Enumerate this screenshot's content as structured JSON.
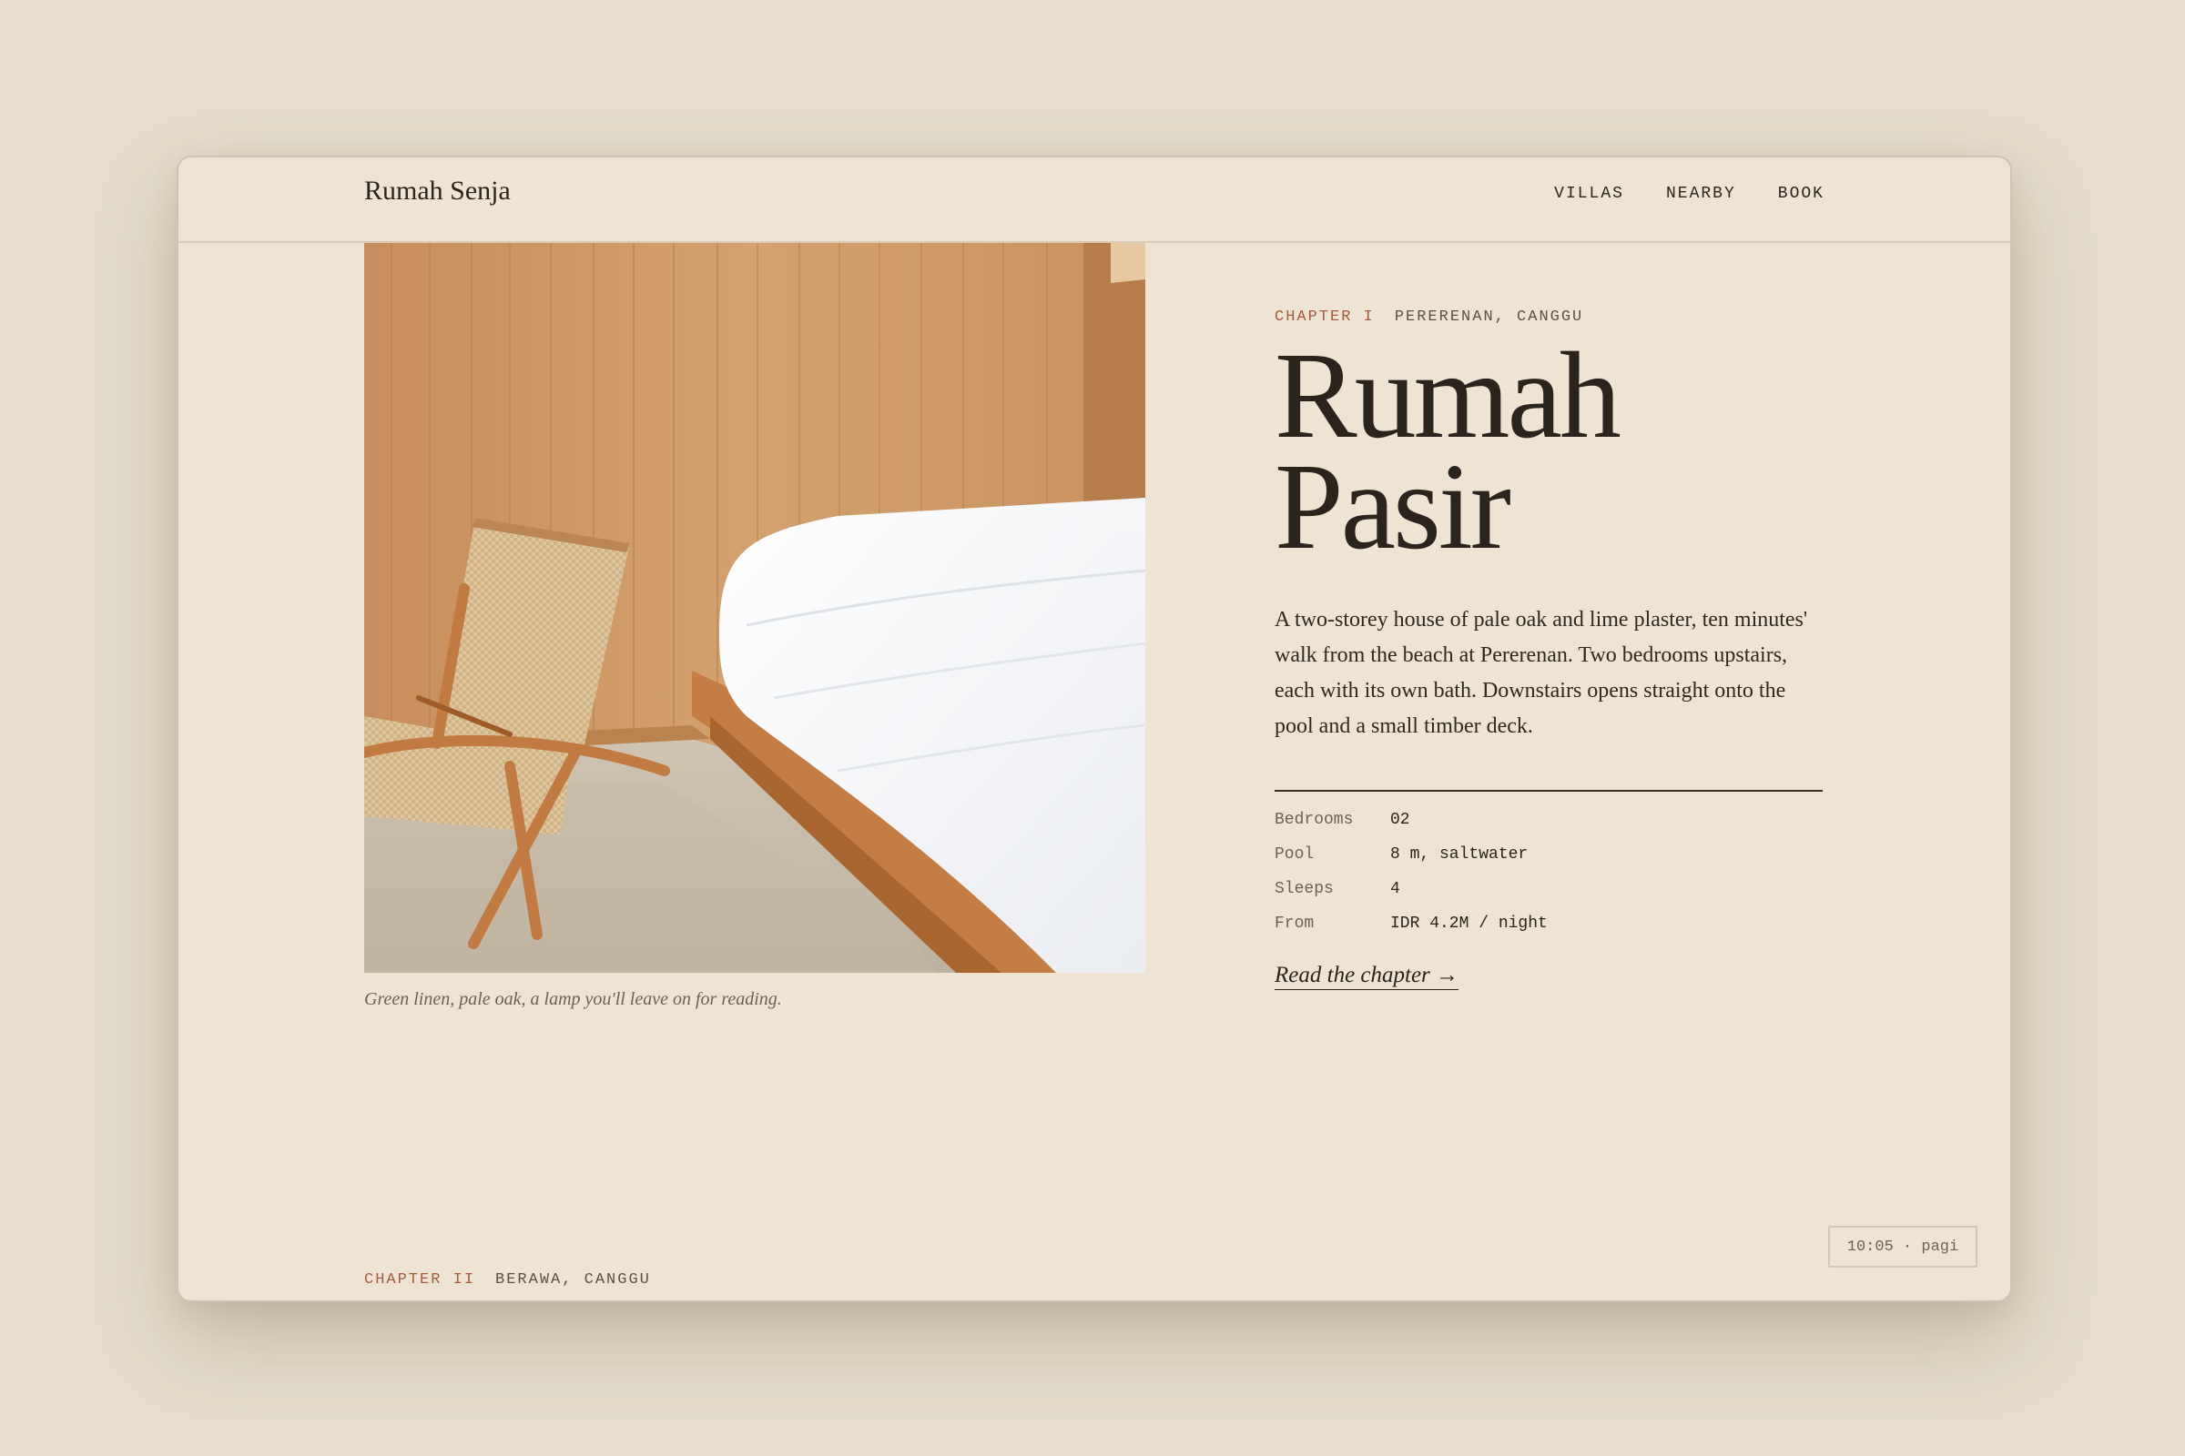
{
  "header": {
    "brand": "Rumah Senja",
    "nav": [
      "VILLAS",
      "NEARBY",
      "BOOK"
    ]
  },
  "photo": {
    "caption": "Green linen, pale oak, a lamp you'll leave on for reading."
  },
  "chapter": {
    "label": "CHAPTER I",
    "location": "PERERENAN, CANGGU",
    "title_line1": "Rumah",
    "title_line2": "Pasir",
    "description": "A two-storey house of pale oak and lime plaster, ten minutes' walk from the beach at Pererenan. Two bedrooms upstairs, each with its own bath. Downstairs opens straight onto the pool and a small timber deck.",
    "specs": [
      {
        "key": "Bedrooms",
        "value": "02"
      },
      {
        "key": "Pool",
        "value": "8 m, saltwater"
      },
      {
        "key": "Sleeps",
        "value": "4"
      },
      {
        "key": "From",
        "value": "IDR 4.2M / night"
      }
    ],
    "link": "Read the chapter →"
  },
  "next_chapter": {
    "label": "CHAPTER II",
    "location": "BERAWA, CANGGU"
  },
  "clock": "10:05 · pagi",
  "colors": {
    "background": "#e6ddcc",
    "panel": "#efe4d3",
    "accent": "#a45a3f",
    "ink": "#2a241d"
  }
}
